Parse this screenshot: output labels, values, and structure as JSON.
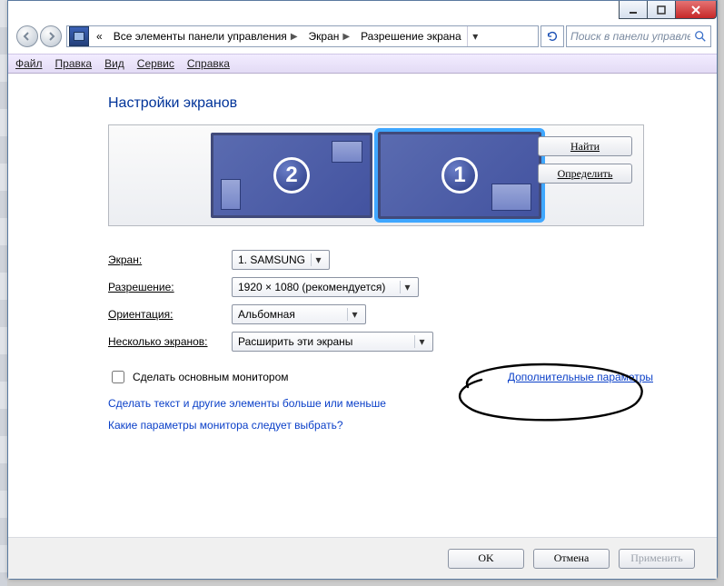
{
  "titlebar": {
    "icons": {
      "min": "—",
      "max": "▢",
      "close": "✕"
    }
  },
  "breadcrumb": {
    "back_sep": "«",
    "item1": "Все элементы панели управления",
    "item2": "Экран",
    "item3": "Разрешение экрана"
  },
  "search": {
    "placeholder": "Поиск в панели управления"
  },
  "menubar": {
    "file": "Файл",
    "edit": "Правка",
    "view": "Вид",
    "service": "Сервис",
    "help": "Справка"
  },
  "page": {
    "title": "Настройки экранов"
  },
  "preview": {
    "monitor1_num": "1",
    "monitor2_num": "2",
    "find_btn": "Найти",
    "identify_btn": "Определить"
  },
  "form": {
    "display_label": "Экран:",
    "display_value": "1. SAMSUNG",
    "resolution_label": "Разрешение:",
    "resolution_value": "1920 × 1080 (рекомендуется)",
    "orientation_label": "Ориентация:",
    "orientation_value": "Альбомная",
    "multi_label": "Несколько экранов:",
    "multi_value": "Расширить эти экраны"
  },
  "checkbox": {
    "label": "Сделать основным монитором"
  },
  "advanced_link": "Дополнительные параметры",
  "links": {
    "text_size": "Сделать текст и другие элементы больше или меньше",
    "which_params": "Какие параметры монитора следует выбрать?"
  },
  "buttons": {
    "ok": "OK",
    "cancel": "Отмена",
    "apply": "Применить"
  }
}
